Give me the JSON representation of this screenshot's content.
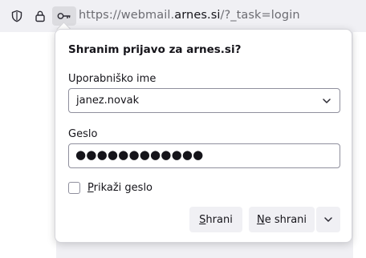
{
  "urlbar": {
    "url_prefix": "https://webmail.",
    "url_domain": "arnes.si",
    "url_suffix": "/?_task=login",
    "icons": [
      "shield-icon",
      "lock-icon",
      "key-icon"
    ]
  },
  "panel": {
    "heading": "Shranim prijavo za arnes.si?",
    "username_label": "Uporabniško ime",
    "username_value": "janez.novak",
    "password_label": "Geslo",
    "password_value": "●●●●●●●●●●●●",
    "show_password_label_prefix": "",
    "show_password_label_accel": "P",
    "show_password_label_rest": "rikaži geslo",
    "show_password_checked": false,
    "save_button_accel": "S",
    "save_button_rest": "hrani",
    "nosave_button_accel": "N",
    "nosave_button_rest": "e shrani"
  },
  "colors": {
    "chrome_bg": "#f0f0f4",
    "panel_bg": "#ffffff",
    "button_bg": "#f0f0f4",
    "field_border": "#8f8f9d",
    "muted_text": "#6c6c72"
  }
}
